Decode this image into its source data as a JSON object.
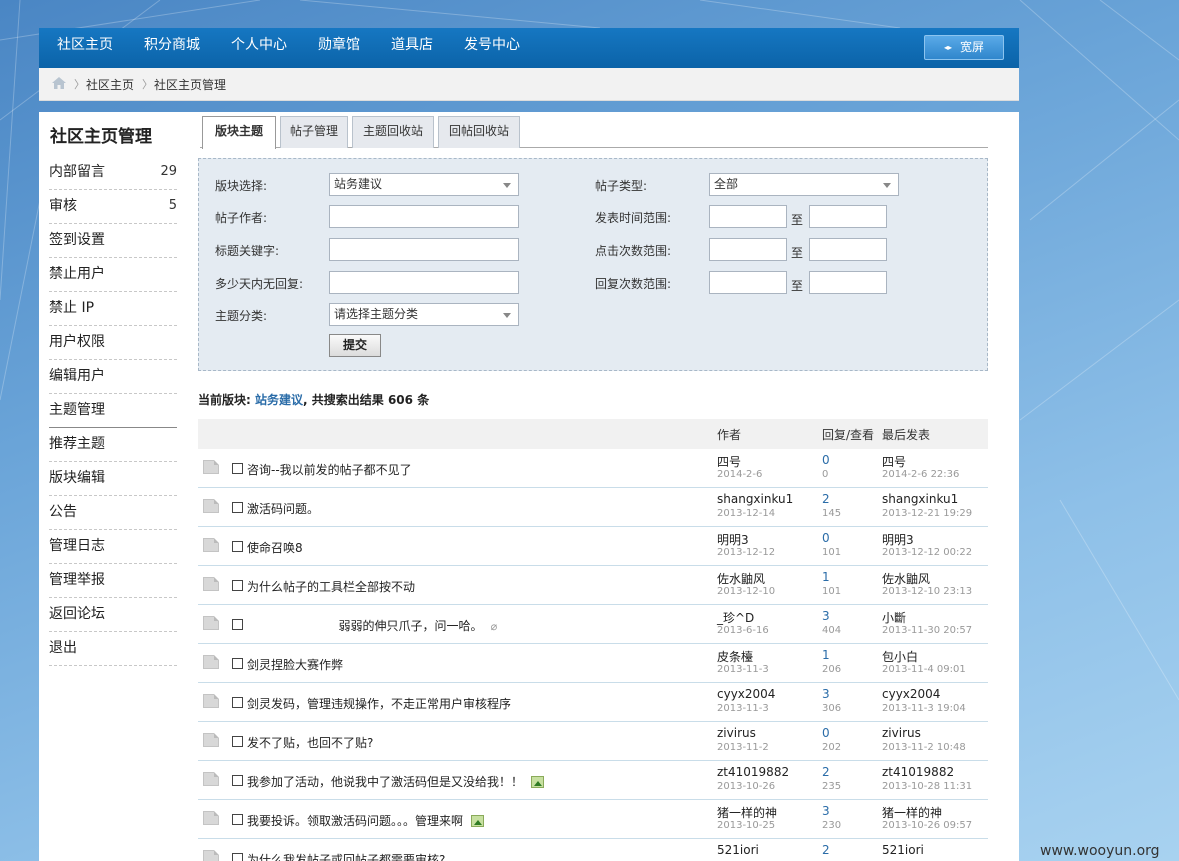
{
  "nav": {
    "items": [
      "社区主页",
      "积分商城",
      "个人中心",
      "勋章馆",
      "道具店",
      "发号中心"
    ],
    "wide_button": "宽屏"
  },
  "breadcrumb": [
    "社区主页",
    "社区主页管理"
  ],
  "sidebar": {
    "title": "社区主页管理",
    "items": [
      {
        "label": "内部留言",
        "count": "29"
      },
      {
        "label": "审核",
        "count": "5"
      },
      {
        "label": "签到设置",
        "count": ""
      },
      {
        "label": "禁止用户",
        "count": ""
      },
      {
        "label": "禁止 IP",
        "count": ""
      },
      {
        "label": "用户权限",
        "count": ""
      },
      {
        "label": "编辑用户",
        "count": ""
      },
      {
        "label": "主题管理",
        "count": ""
      },
      {
        "label": "推荐主题",
        "count": ""
      },
      {
        "label": "版块编辑",
        "count": ""
      },
      {
        "label": "公告",
        "count": ""
      },
      {
        "label": "管理日志",
        "count": ""
      },
      {
        "label": "管理举报",
        "count": ""
      },
      {
        "label": "返回论坛",
        "count": ""
      },
      {
        "label": "退出",
        "count": ""
      }
    ]
  },
  "tabs": [
    "版块主题",
    "帖子管理",
    "主题回收站",
    "回帖回收站"
  ],
  "filter": {
    "board_label": "版块选择:",
    "board_value": "站务建议",
    "author_label": "帖子作者:",
    "keyword_label": "标题关键字:",
    "noreply_label": "多少天内无回复:",
    "category_label": "主题分类:",
    "category_value": "请选择主题分类",
    "type_label": "帖子类型:",
    "type_value": "全部",
    "time_label": "发表时间范围:",
    "click_label": "点击次数范围:",
    "reply_label": "回复次数范围:",
    "to_text": "至",
    "submit_label": "提交"
  },
  "result": {
    "prefix": "当前版块:",
    "board": "站务建议",
    "middle": ", 共搜索出结果",
    "count": "606",
    "suffix": "条"
  },
  "table": {
    "headers": {
      "author": "作者",
      "reply": "回复/查看",
      "last": "最后发表"
    },
    "rows": [
      {
        "title": "咨询--我以前发的帖子都不见了",
        "author": "四号",
        "date": "2014-2-6",
        "replies": "0",
        "views": "0",
        "last_user": "四号",
        "last_time": "2014-2-6 22:36",
        "attach": ""
      },
      {
        "title": "激活码问题。",
        "author": "shangxinku1",
        "date": "2013-12-14",
        "replies": "2",
        "views": "145",
        "last_user": "shangxinku1",
        "last_time": "2013-12-21 19:29",
        "attach": ""
      },
      {
        "title": "使命召唤8",
        "author": "明明3",
        "date": "2013-12-12",
        "replies": "0",
        "views": "101",
        "last_user": "明明3",
        "last_time": "2013-12-12 00:22",
        "attach": ""
      },
      {
        "title": "为什么帖子的工具栏全部按不动",
        "author": "佐水鼬风",
        "date": "2013-12-10",
        "replies": "1",
        "views": "101",
        "last_user": "佐水鼬风",
        "last_time": "2013-12-10 23:13",
        "attach": ""
      },
      {
        "title": "                        弱弱的伸只爪子，问一哈。",
        "author": "_珍^D",
        "date": "2013-6-16",
        "replies": "3",
        "views": "404",
        "last_user": "小斷",
        "last_time": "2013-11-30 20:57",
        "attach": "clip"
      },
      {
        "title": "剑灵捏脸大赛作弊",
        "author": "皮条檯",
        "date": "2013-11-3",
        "replies": "1",
        "views": "206",
        "last_user": "包小白",
        "last_time": "2013-11-4 09:01",
        "attach": ""
      },
      {
        "title": "剑灵发码，管理违规操作，不走正常用户审核程序",
        "author": "cyyx2004",
        "date": "2013-11-3",
        "replies": "3",
        "views": "306",
        "last_user": "cyyx2004",
        "last_time": "2013-11-3 19:04",
        "attach": ""
      },
      {
        "title": "发不了贴，也回不了贴?",
        "author": "zivirus",
        "date": "2013-11-2",
        "replies": "0",
        "views": "202",
        "last_user": "zivirus",
        "last_time": "2013-11-2 10:48",
        "attach": ""
      },
      {
        "title": "我参加了活动，他说我中了激活码但是又没给我！！",
        "author": "zt41019882",
        "date": "2013-10-26",
        "replies": "2",
        "views": "235",
        "last_user": "zt41019882",
        "last_time": "2013-10-28 11:31",
        "attach": "image"
      },
      {
        "title": "我要投诉。领取激活码问题。。。管理来啊",
        "author": "猪一样的神",
        "date": "2013-10-25",
        "replies": "3",
        "views": "230",
        "last_user": "猪一样的神",
        "last_time": "2013-10-26 09:57",
        "attach": "image"
      },
      {
        "title": "为什么我发帖子或回帖子都需要审核?",
        "author": "521iori",
        "date": "",
        "replies": "2",
        "views": "",
        "last_user": "521iori",
        "last_time": "",
        "attach": ""
      }
    ]
  },
  "watermark": "www.wooyun.org"
}
